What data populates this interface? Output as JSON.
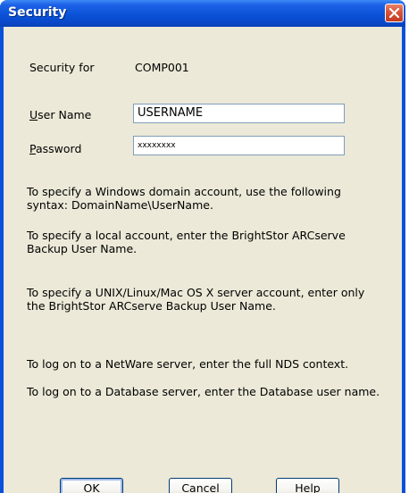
{
  "window": {
    "title": "Security"
  },
  "security_for": {
    "label": "Security for",
    "value": "COMP001"
  },
  "username": {
    "label_mnemonic": "U",
    "label_rest": "ser Name",
    "value": "USERNAME"
  },
  "password": {
    "label_mnemonic": "P",
    "label_rest": "assword",
    "value": "xxxxxxxx"
  },
  "help_text": [
    "To specify a Windows domain account, use the following syntax: DomainName\\UserName.",
    "To specify a local account, enter the BrightStor ARCserve Backup User Name.",
    "To specify a UNIX/Linux/Mac OS X server account, enter only the BrightStor ARCserve Backup User Name.",
    "To log on to a NetWare server, enter the full NDS context.",
    "To log on to a Database server, enter the Database user name."
  ],
  "buttons": {
    "ok": {
      "mnemonic": "O",
      "rest": "K"
    },
    "cancel": {
      "mnemonic": "C",
      "rest": "ancel"
    },
    "help": {
      "mnemonic": "H",
      "rest": "elp"
    }
  },
  "icons": {
    "close": "close-icon"
  },
  "colors": {
    "titlebar": "#0a52d8",
    "client": "#ece9d8",
    "close": "#d9533a"
  }
}
